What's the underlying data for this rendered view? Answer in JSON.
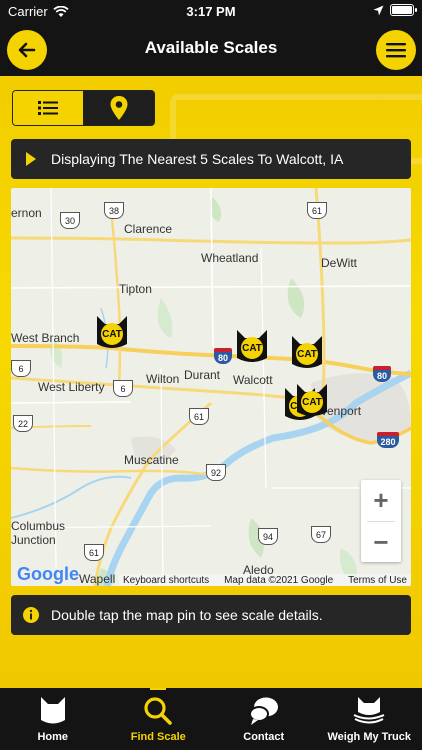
{
  "status_bar": {
    "carrier": "Carrier",
    "time": "3:17 PM"
  },
  "header": {
    "title": "Available Scales",
    "back_icon": "arrow-left-icon",
    "menu_icon": "hamburger-menu-icon"
  },
  "view_toggle": {
    "list_icon": "list-icon",
    "map_icon": "map-pin-icon",
    "selected": "map"
  },
  "banner_top": {
    "text": "Displaying The Nearest 5 Scales To Walcott, IA"
  },
  "banner_bottom": {
    "text": "Double tap the map pin to see scale details."
  },
  "map": {
    "towns": {
      "vernon": "ernon",
      "clarence": "Clarence",
      "wheatland": "Wheatland",
      "dewitt": "DeWitt",
      "tipton": "Tipton",
      "west_branch": "West Branch",
      "west_liberty": "West Liberty",
      "wilton": "Wilton",
      "durant": "Durant",
      "walcott": "Walcott",
      "davenport": "venport",
      "muscatine": "Muscatine",
      "columbus_junction": "Columbus\nJunction",
      "wapello": "Wapell",
      "aledo": "Aledo"
    },
    "routes": {
      "r30": "30",
      "r38": "38",
      "r61a": "61",
      "r6a": "6",
      "r6b": "6",
      "r22": "22",
      "r61b": "61",
      "r61c": "61",
      "r92": "92",
      "r94": "94",
      "r67": "67",
      "i80a": "80",
      "i80b": "80",
      "i280": "280"
    },
    "pins_label": "CAT",
    "pin_count": 5,
    "google": "Google",
    "footer": {
      "shortcuts": "Keyboard shortcuts",
      "data": "Map data ©2021 Google",
      "terms": "Terms of Use"
    },
    "zoom_in": "+",
    "zoom_out": "−"
  },
  "tabs": [
    {
      "label": "Home",
      "icon": "cat-head-icon",
      "active": false
    },
    {
      "label": "Find Scale",
      "icon": "search-icon",
      "active": true
    },
    {
      "label": "Contact",
      "icon": "chat-bubbles-icon",
      "active": false
    },
    {
      "label": "Weigh My Truck",
      "icon": "cat-truck-icon",
      "active": false
    }
  ],
  "colors": {
    "accent": "#f5d300",
    "dark": "#141414",
    "banner": "#262626"
  }
}
